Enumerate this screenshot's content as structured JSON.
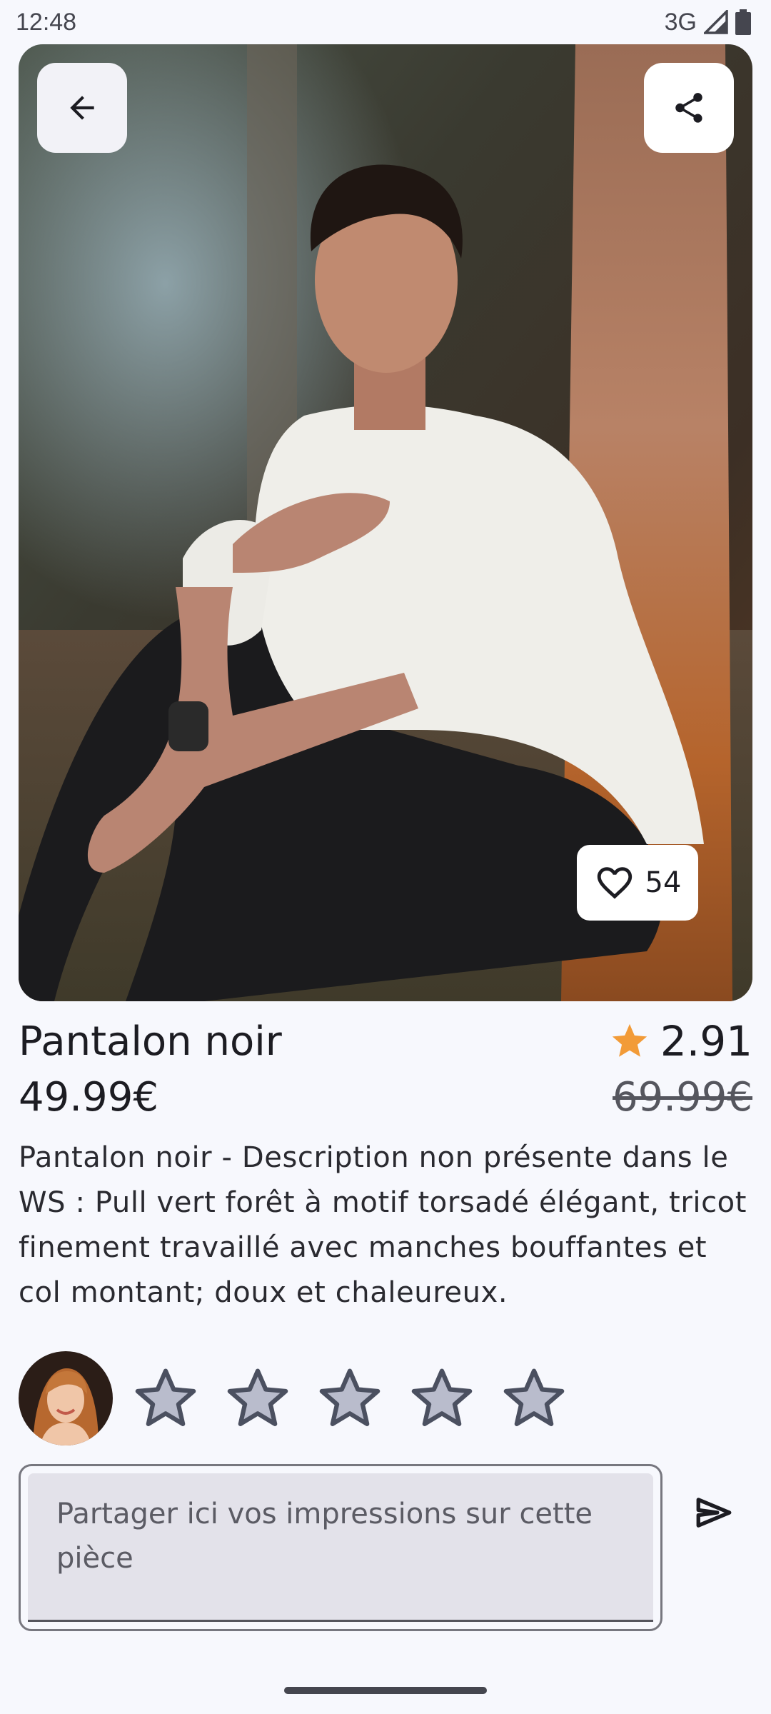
{
  "status": {
    "time": "12:48",
    "network": "3G"
  },
  "product": {
    "name": "Pantalon noir",
    "price": "49.99€",
    "old_price": "69.99€",
    "rating": "2.91",
    "likes": "54",
    "description": "Pantalon noir - Description non présente dans le WS : Pull vert forêt à motif torsadé élégant, tricot finement travaillé avec manches bouffantes et col montant; doux et chaleureux."
  },
  "review": {
    "star_count": 5,
    "selected_stars": 0,
    "placeholder": "Partager ici vos impressions sur cette pièce"
  },
  "colors": {
    "background": "#f7f8fd",
    "accent_star": "#f29b38",
    "empty_star_fill": "#b9bccc",
    "empty_star_stroke": "#4b5060"
  },
  "icons": {
    "back": "arrow-left-icon",
    "share": "share-icon",
    "like": "heart-outline-icon",
    "rating": "star-icon",
    "send": "send-icon"
  }
}
